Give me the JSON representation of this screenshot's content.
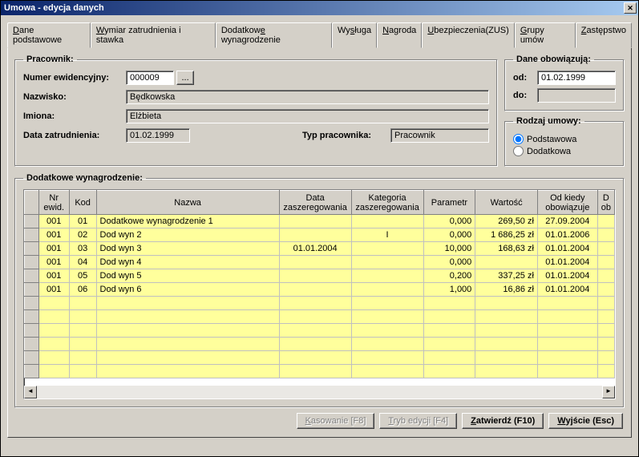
{
  "window": {
    "title": "Umowa - edycja danych",
    "close_glyph": "✕"
  },
  "tabs": [
    {
      "label": "Dane podstawowe",
      "u": "D"
    },
    {
      "label": "Wymiar zatrudnienia i stawka",
      "u": "W"
    },
    {
      "label": "Dodatkowe wynagrodzenie",
      "u": "e",
      "active": true
    },
    {
      "label": "Wysługa",
      "u": "s"
    },
    {
      "label": "Nagroda",
      "u": "N"
    },
    {
      "label": "Ubezpieczenia(ZUS)",
      "u": "U"
    },
    {
      "label": "Grupy umów",
      "u": "G"
    },
    {
      "label": "Zastępstwo",
      "u": "Z"
    }
  ],
  "pracownik": {
    "legend": "Pracownik:",
    "numer_label": "Numer ewidencyjny:",
    "numer_value": "000009",
    "ellipsis": "...",
    "nazwisko_label": "Nazwisko:",
    "nazwisko_value": "Będkowska",
    "imiona_label": "Imiona:",
    "imiona_value": "Elżbieta",
    "data_zatr_label": "Data zatrudnienia:",
    "data_zatr_value": "01.02.1999",
    "typ_label": "Typ pracownika:",
    "typ_value": "Pracownik"
  },
  "dane_obow": {
    "legend": "Dane obowiązują:",
    "od_label": "od:",
    "od_value": "01.02.1999",
    "do_label": "do:",
    "do_value": ""
  },
  "rodzaj": {
    "legend": "Rodzaj umowy:",
    "opt1": "Podstawowa",
    "opt2": "Dodatkowa",
    "selected": "Podstawowa"
  },
  "grid": {
    "legend": "Dodatkowe wynagrodzenie:",
    "headers": {
      "nr": "Nr\newid.",
      "kod": "Kod",
      "nazwa": "Nazwa",
      "data_zasz": "Data\nzaszeregowania",
      "kat": "Kategoria\nzaszeregowania",
      "param": "Parametr",
      "wartosc": "Wartość",
      "od_kiedy": "Od kiedy\nobowiązuje",
      "do_kiedy": "D\nob"
    },
    "rows": [
      {
        "nr": "001",
        "kod": "01",
        "nazwa": "Dodatkowe wynagrodzenie 1",
        "data_zasz": "",
        "kat": "",
        "param": "0,000",
        "wartosc": "269,50 zł",
        "od_kiedy": "27.09.2004"
      },
      {
        "nr": "001",
        "kod": "02",
        "nazwa": "Dod wyn 2",
        "data_zasz": "",
        "kat": "I",
        "param": "0,000",
        "wartosc": "1 686,25 zł",
        "od_kiedy": "01.01.2006"
      },
      {
        "nr": "001",
        "kod": "03",
        "nazwa": "Dod wyn 3",
        "data_zasz": "01.01.2004",
        "kat": "",
        "param": "10,000",
        "wartosc": "168,63 zł",
        "od_kiedy": "01.01.2004"
      },
      {
        "nr": "001",
        "kod": "04",
        "nazwa": "Dod wyn 4",
        "data_zasz": "",
        "kat": "",
        "param": "0,000",
        "wartosc": "",
        "od_kiedy": "01.01.2004"
      },
      {
        "nr": "001",
        "kod": "05",
        "nazwa": "Dod wyn 5",
        "data_zasz": "",
        "kat": "",
        "param": "0,200",
        "wartosc": "337,25 zł",
        "od_kiedy": "01.01.2004"
      },
      {
        "nr": "001",
        "kod": "06",
        "nazwa": "Dod wyn 6",
        "data_zasz": "",
        "kat": "",
        "param": "1,000",
        "wartosc": "16,86 zł",
        "od_kiedy": "01.01.2004"
      }
    ],
    "scroll": {
      "left": "◄",
      "right": "►"
    }
  },
  "footer": {
    "kasowanie": "Kasowanie [F8]",
    "tryb": "Tryb edycji [F4]",
    "zatwierdz": "Zatwierdź (F10)",
    "wyjscie": "Wyjście (Esc)"
  }
}
